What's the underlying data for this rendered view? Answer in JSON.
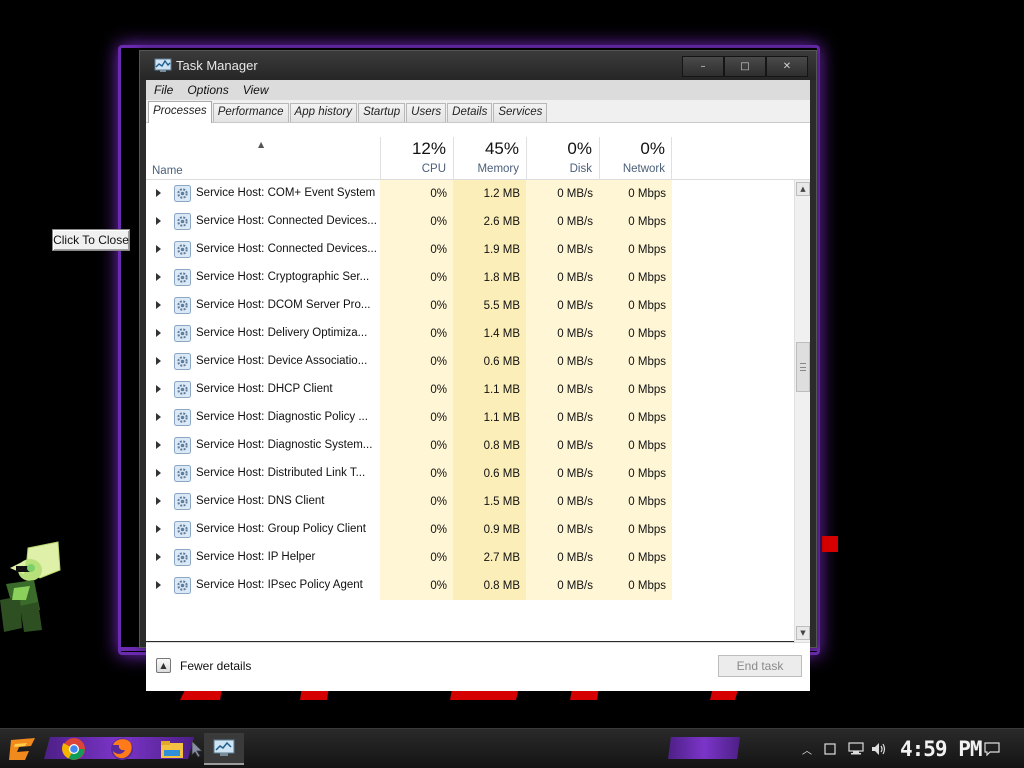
{
  "desktop": {
    "click_to_close": "Click To Close",
    "accent_purple": "#7b2cc8",
    "accent_red": "#d50000"
  },
  "window": {
    "title": "Task Manager",
    "controls": {
      "minimize": "–",
      "maximize": "□",
      "close": "✕"
    }
  },
  "menu": [
    "File",
    "Options",
    "View"
  ],
  "tabs": [
    {
      "label": "Processes",
      "active": true
    },
    {
      "label": "Performance",
      "active": false
    },
    {
      "label": "App history",
      "active": false
    },
    {
      "label": "Startup",
      "active": false
    },
    {
      "label": "Users",
      "active": false
    },
    {
      "label": "Details",
      "active": false
    },
    {
      "label": "Services",
      "active": false
    }
  ],
  "columns": {
    "name": "Name",
    "cpu": {
      "percent": "12%",
      "label": "CPU"
    },
    "memory": {
      "percent": "45%",
      "label": "Memory"
    },
    "disk": {
      "percent": "0%",
      "label": "Disk"
    },
    "network": {
      "percent": "0%",
      "label": "Network"
    }
  },
  "processes": [
    {
      "name": "Service Host: COM+ Event System",
      "cpu": "0%",
      "memory": "1.2 MB",
      "disk": "0 MB/s",
      "network": "0 Mbps"
    },
    {
      "name": "Service Host: Connected Devices...",
      "cpu": "0%",
      "memory": "2.6 MB",
      "disk": "0 MB/s",
      "network": "0 Mbps"
    },
    {
      "name": "Service Host: Connected Devices...",
      "cpu": "0%",
      "memory": "1.9 MB",
      "disk": "0 MB/s",
      "network": "0 Mbps"
    },
    {
      "name": "Service Host: Cryptographic Ser...",
      "cpu": "0%",
      "memory": "1.8 MB",
      "disk": "0 MB/s",
      "network": "0 Mbps"
    },
    {
      "name": "Service Host: DCOM Server Pro...",
      "cpu": "0%",
      "memory": "5.5 MB",
      "disk": "0 MB/s",
      "network": "0 Mbps"
    },
    {
      "name": "Service Host: Delivery Optimiza...",
      "cpu": "0%",
      "memory": "1.4 MB",
      "disk": "0 MB/s",
      "network": "0 Mbps"
    },
    {
      "name": "Service Host: Device Associatio...",
      "cpu": "0%",
      "memory": "0.6 MB",
      "disk": "0 MB/s",
      "network": "0 Mbps"
    },
    {
      "name": "Service Host: DHCP Client",
      "cpu": "0%",
      "memory": "1.1 MB",
      "disk": "0 MB/s",
      "network": "0 Mbps"
    },
    {
      "name": "Service Host: Diagnostic Policy ...",
      "cpu": "0%",
      "memory": "1.1 MB",
      "disk": "0 MB/s",
      "network": "0 Mbps"
    },
    {
      "name": "Service Host: Diagnostic System...",
      "cpu": "0%",
      "memory": "0.8 MB",
      "disk": "0 MB/s",
      "network": "0 Mbps"
    },
    {
      "name": "Service Host: Distributed Link T...",
      "cpu": "0%",
      "memory": "0.6 MB",
      "disk": "0 MB/s",
      "network": "0 Mbps"
    },
    {
      "name": "Service Host: DNS Client",
      "cpu": "0%",
      "memory": "1.5 MB",
      "disk": "0 MB/s",
      "network": "0 Mbps"
    },
    {
      "name": "Service Host: Group Policy Client",
      "cpu": "0%",
      "memory": "0.9 MB",
      "disk": "0 MB/s",
      "network": "0 Mbps"
    },
    {
      "name": "Service Host: IP Helper",
      "cpu": "0%",
      "memory": "2.7 MB",
      "disk": "0 MB/s",
      "network": "0 Mbps"
    },
    {
      "name": "Service Host: IPsec Policy Agent",
      "cpu": "0%",
      "memory": "0.8 MB",
      "disk": "0 MB/s",
      "network": "0 Mbps"
    }
  ],
  "footer": {
    "fewer_details": "Fewer details",
    "end_task": "End task"
  },
  "taskbar": {
    "icons": [
      "start-logo-icon",
      "chrome-icon",
      "firefox-icon",
      "file-explorer-icon",
      "task-manager-icon"
    ],
    "clock": "4:59 PM"
  }
}
